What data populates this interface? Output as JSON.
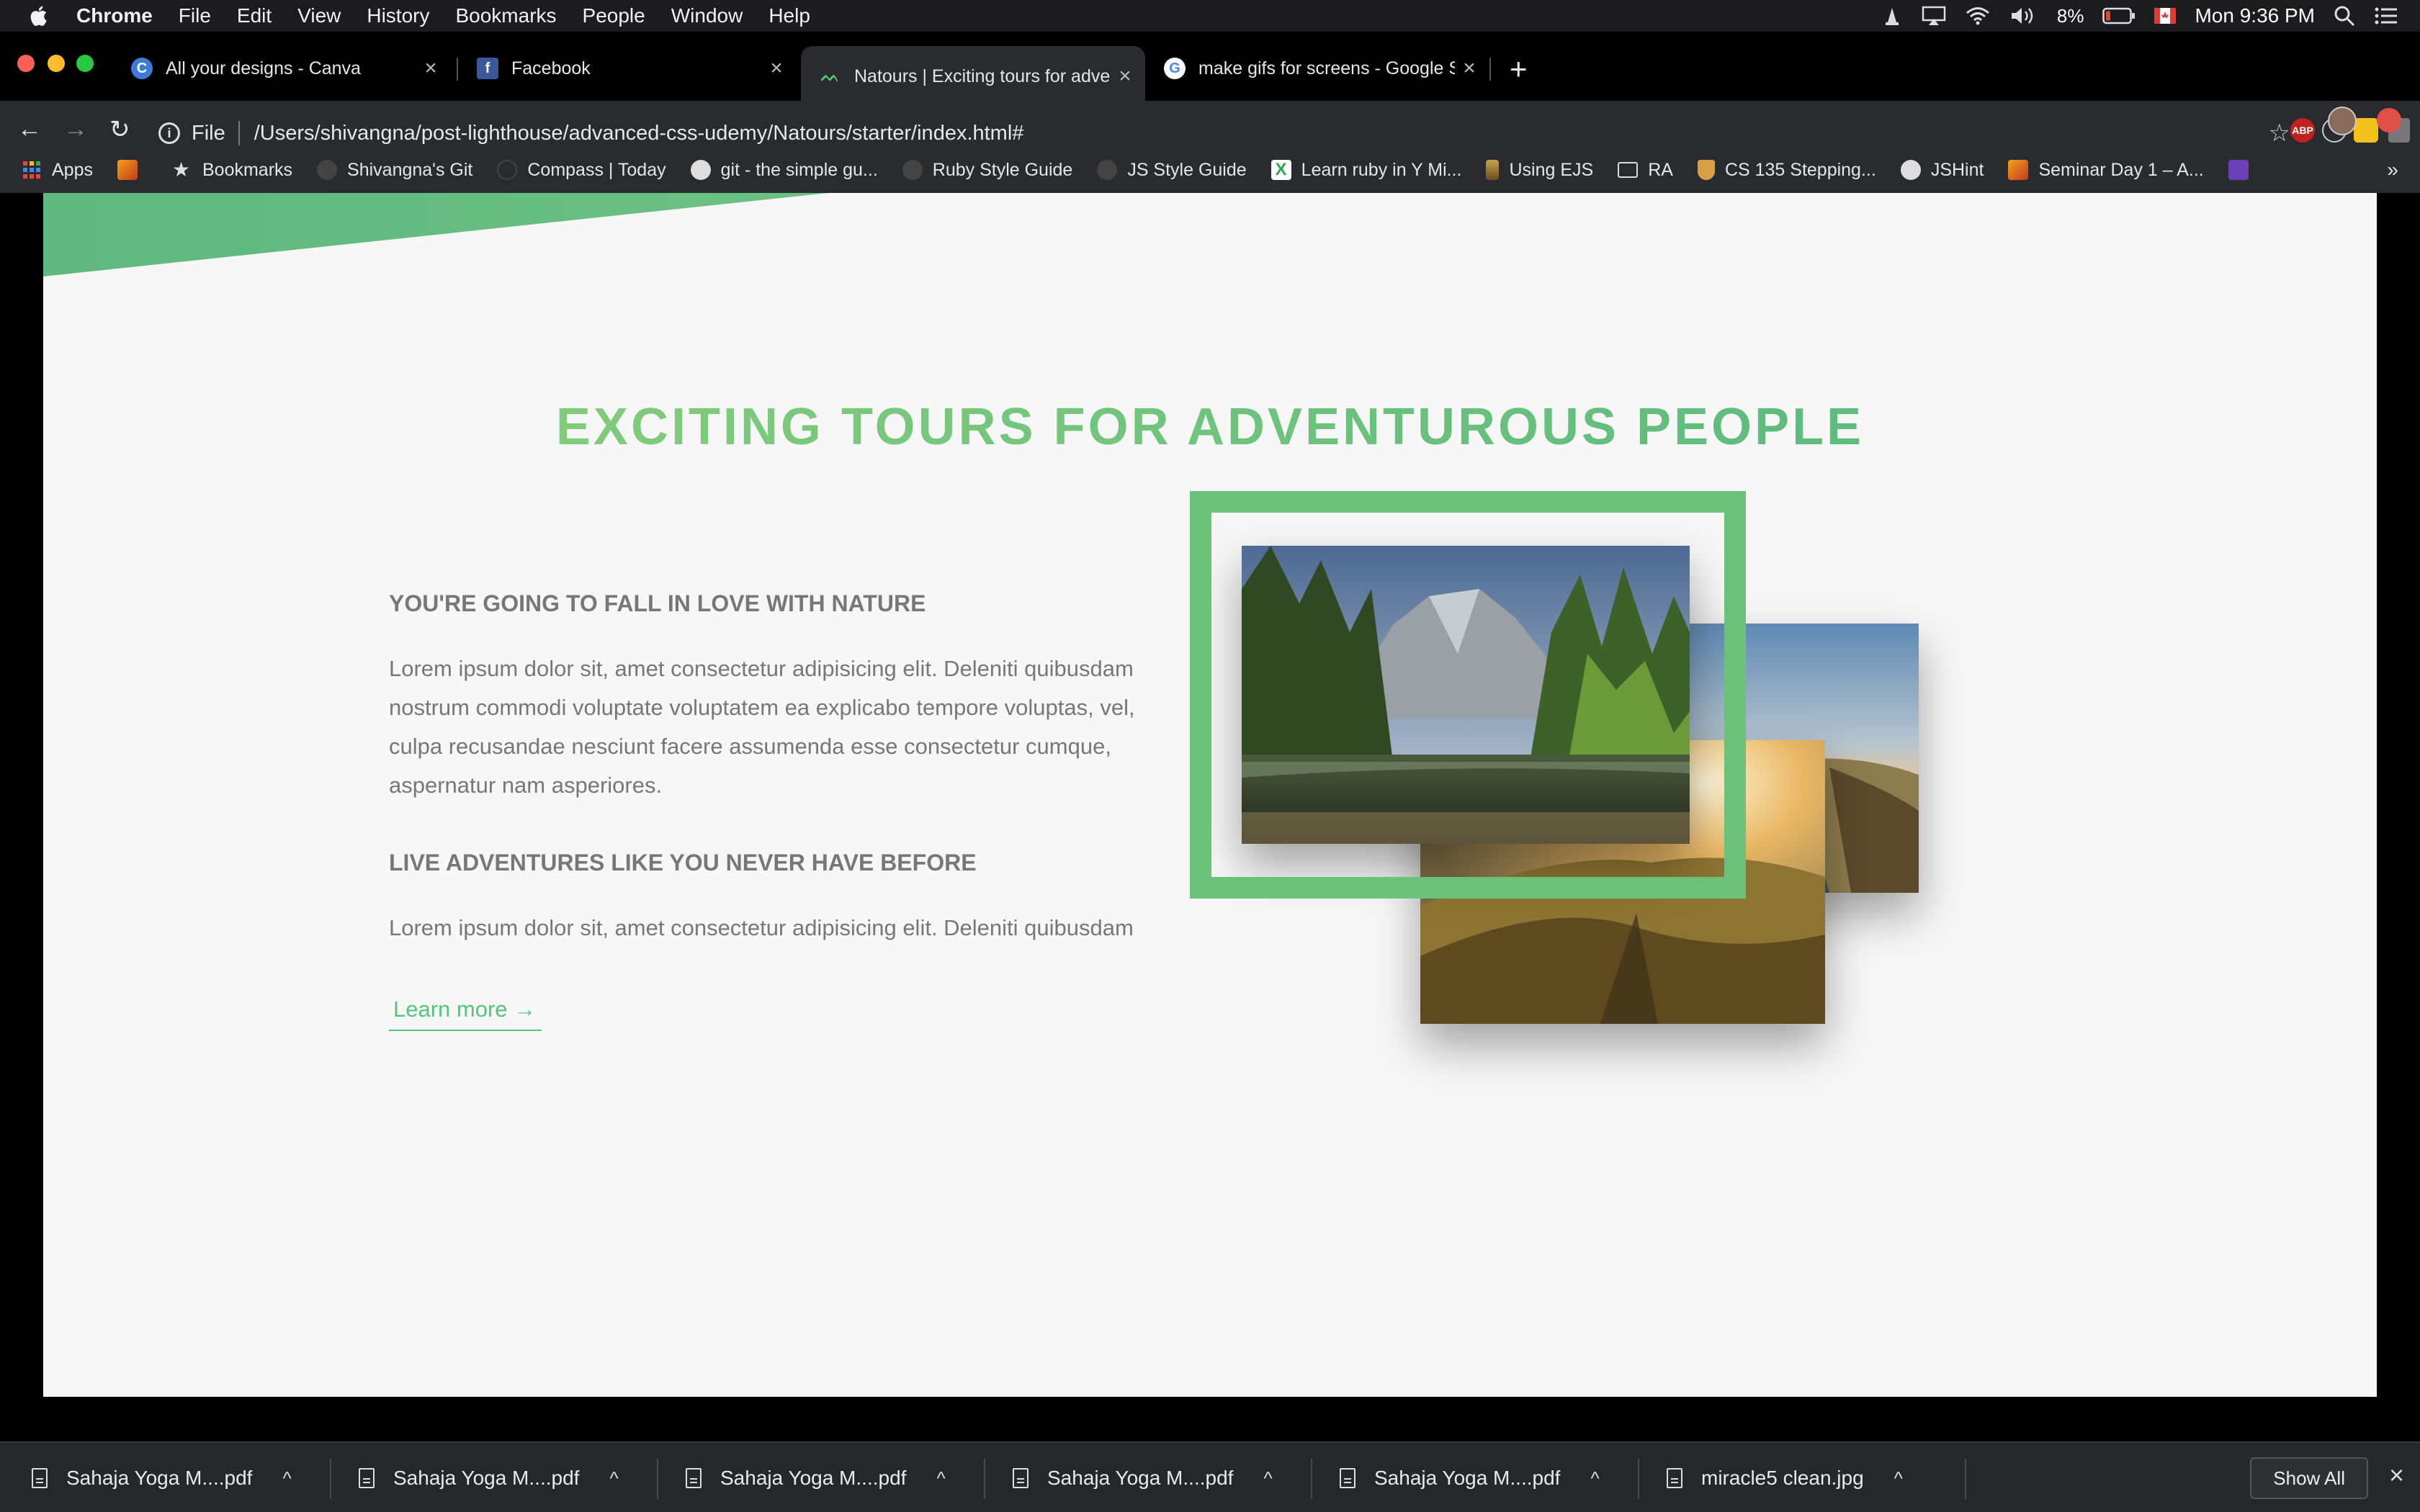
{
  "menubar": {
    "app": "Chrome",
    "items": [
      "File",
      "Edit",
      "View",
      "History",
      "Bookmarks",
      "People",
      "Window",
      "Help"
    ],
    "battery": "8%",
    "clock": "Mon 9:36 PM"
  },
  "tabs": [
    {
      "title": "All your designs - Canva",
      "icon": "canva-icon"
    },
    {
      "title": "Facebook",
      "icon": "facebook-icon"
    },
    {
      "title": "Natours | Exciting tours for adventurous people",
      "icon": "natours-icon"
    },
    {
      "title": "make gifs for screens - Google Search",
      "icon": "google-icon"
    }
  ],
  "toolbar": {
    "scheme": "File",
    "url": "/Users/shivangna/post-lighthouse/advanced-css-udemy/Natours/starter/index.html#"
  },
  "bookmarks": [
    "Apps",
    "",
    "Bookmarks",
    "Shivangna's Git",
    "Compass | Today",
    "git - the simple gu...",
    "Ruby Style Guide",
    "JS Style Guide",
    "Learn ruby in Y Mi...",
    "Using EJS",
    "RA",
    "CS 135 Stepping...",
    "JSHint",
    "Seminar Day 1 – A...",
    ""
  ],
  "page": {
    "heading": "Exciting tours for adventurous people",
    "sub1": "You're going to fall in love with nature",
    "para1": "Lorem ipsum dolor sit, amet consectetur adipisicing elit. Deleniti quibusdam nostrum commodi voluptate voluptatem ea explicabo tempore voluptas, vel, culpa recusandae nesciunt facere assumenda esse consectetur cumque, aspernatur nam asperiores.",
    "sub2": "Live adventures like you never have before",
    "para2": "Lorem ipsum dolor sit, amet consectetur adipisicing elit. Deleniti quibusdam",
    "learn_more": "Learn more →"
  },
  "downloads": [
    "Sahaja Yoga M....pdf",
    "Sahaja Yoga M....pdf",
    "Sahaja Yoga M....pdf",
    "Sahaja Yoga M....pdf",
    "Sahaja Yoga M....pdf",
    "miracle5 clean.jpg"
  ],
  "shelf": {
    "show_all": "Show All"
  },
  "colors": {
    "primary": "#55c57a",
    "primary_light": "#7ed56f",
    "text_grey": "#777777",
    "page_bg": "#f7f7f7"
  }
}
